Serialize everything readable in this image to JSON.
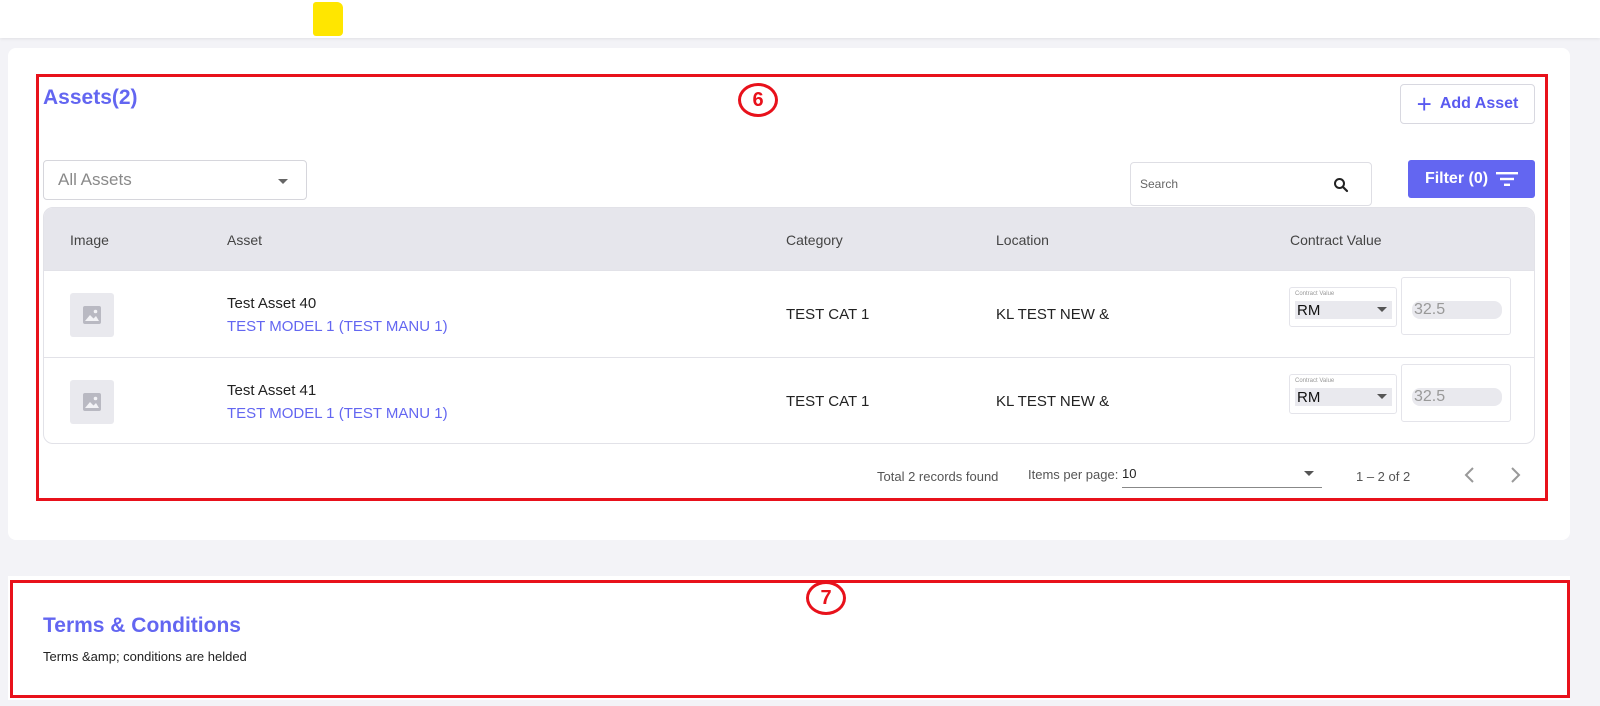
{
  "assets": {
    "title": "Assets(2)",
    "add_label": "Add Asset",
    "select_value": "All Assets",
    "search_placeholder": "Search",
    "filter_label": "Filter  (0)",
    "columns": [
      "Image",
      "Asset",
      "Category",
      "Location",
      "Contract Value"
    ],
    "rows": [
      {
        "name": "Test Asset 40",
        "model": "TEST MODEL 1 (TEST MANU 1)",
        "category": "TEST CAT 1",
        "location": "KL TEST NEW &",
        "cv_label": "Contract Value",
        "currency": "RM",
        "amount": "32.5"
      },
      {
        "name": "Test Asset 41",
        "model": "TEST MODEL 1 (TEST MANU 1)",
        "category": "TEST CAT 1",
        "location": "KL TEST NEW &",
        "cv_label": "Contract Value",
        "currency": "RM",
        "amount": "32.5"
      }
    ],
    "pager": {
      "total": "Total 2 records found",
      "items_label": "Items per page:",
      "items_value": "10",
      "range": "1 – 2 of 2"
    }
  },
  "terms": {
    "title": "Terms & Conditions",
    "text": "Terms &amp; conditions are helded"
  },
  "annotations": {
    "first": "6",
    "second": "7"
  },
  "colors": {
    "accent": "#6366f1",
    "annotation": "#e8111b",
    "highlight": "#ffe600"
  }
}
